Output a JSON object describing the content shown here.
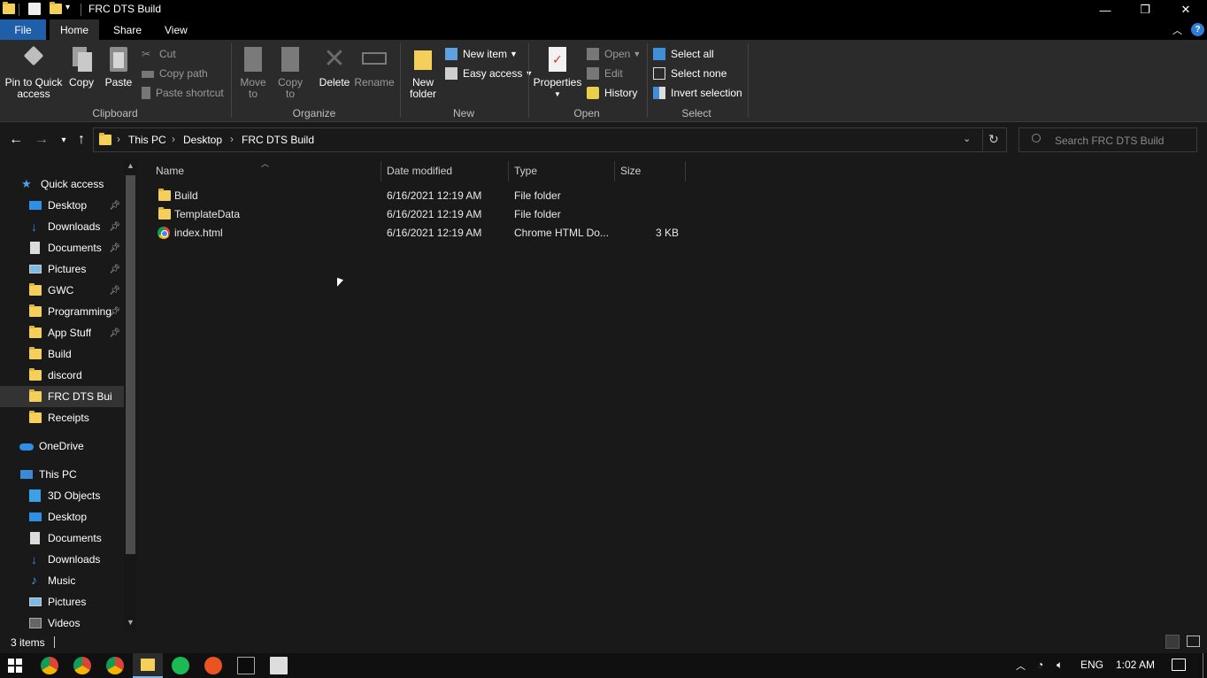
{
  "window": {
    "title": "FRC DTS Build"
  },
  "ribbon_tabs": [
    "File",
    "Home",
    "Share",
    "View"
  ],
  "ribbon": {
    "clipboard": {
      "label": "Clipboard",
      "pin": "Pin to Quick access",
      "copy": "Copy",
      "paste": "Paste",
      "cut": "Cut",
      "copy_path": "Copy path",
      "paste_shortcut": "Paste shortcut"
    },
    "organize": {
      "label": "Organize",
      "move_to": "Move to",
      "copy_to": "Copy to",
      "delete": "Delete",
      "rename": "Rename"
    },
    "new": {
      "label": "New",
      "new_folder": "New folder",
      "new_item": "New item",
      "easy_access": "Easy access"
    },
    "open": {
      "label": "Open",
      "properties": "Properties",
      "open": "Open",
      "edit": "Edit",
      "history": "History"
    },
    "select": {
      "label": "Select",
      "select_all": "Select all",
      "select_none": "Select none",
      "invert_selection": "Invert selection"
    }
  },
  "address": {
    "crumbs": [
      "This PC",
      "Desktop",
      "FRC DTS Build"
    ],
    "search_placeholder": "Search FRC DTS Build"
  },
  "nav_pane": {
    "quick_access": "Quick access",
    "quick_items": [
      {
        "label": "Desktop",
        "icon": "desktop-icon",
        "pinned": true
      },
      {
        "label": "Downloads",
        "icon": "downloads-icon",
        "pinned": true
      },
      {
        "label": "Documents",
        "icon": "documents-icon",
        "pinned": true
      },
      {
        "label": "Pictures",
        "icon": "pictures-icon",
        "pinned": true
      },
      {
        "label": "GWC",
        "icon": "folder-icon",
        "pinned": true
      },
      {
        "label": "Programming",
        "icon": "folder-icon",
        "pinned": true
      },
      {
        "label": "App Stuff",
        "icon": "folder-icon",
        "pinned": true
      },
      {
        "label": "Build",
        "icon": "folder-icon",
        "pinned": false
      },
      {
        "label": "discord",
        "icon": "folder-icon",
        "pinned": false
      },
      {
        "label": "FRC DTS Build",
        "icon": "folder-icon",
        "pinned": false
      },
      {
        "label": "Receipts",
        "icon": "folder-icon",
        "pinned": false
      }
    ],
    "onedrive": "OneDrive",
    "this_pc": "This PC",
    "pc_items": [
      {
        "label": "3D Objects",
        "icon": "3d-objects-icon"
      },
      {
        "label": "Desktop",
        "icon": "desktop-icon"
      },
      {
        "label": "Documents",
        "icon": "documents-icon"
      },
      {
        "label": "Downloads",
        "icon": "downloads-icon"
      },
      {
        "label": "Music",
        "icon": "music-icon"
      },
      {
        "label": "Pictures",
        "icon": "pictures-icon"
      },
      {
        "label": "Videos",
        "icon": "videos-icon"
      }
    ]
  },
  "file_list": {
    "columns": [
      "Name",
      "Date modified",
      "Type",
      "Size"
    ],
    "rows": [
      {
        "name": "Build",
        "date": "6/16/2021 12:19 AM",
        "type": "File folder",
        "size": "",
        "icon": "folder-icon"
      },
      {
        "name": "TemplateData",
        "date": "6/16/2021 12:19 AM",
        "type": "File folder",
        "size": "",
        "icon": "folder-icon"
      },
      {
        "name": "index.html",
        "date": "6/16/2021 12:19 AM",
        "type": "Chrome HTML Do...",
        "size": "3 KB",
        "icon": "chrome-html-icon"
      }
    ]
  },
  "status": {
    "items": "3 items"
  },
  "taskbar": {
    "language": "ENG",
    "time": "1:02 AM"
  },
  "colors": {
    "file_tab": "#1f5ea8",
    "ribbon_bg": "#2b2b2b",
    "background": "#191919",
    "folder": "#f4cf59",
    "accent": "#2d8fe6"
  }
}
